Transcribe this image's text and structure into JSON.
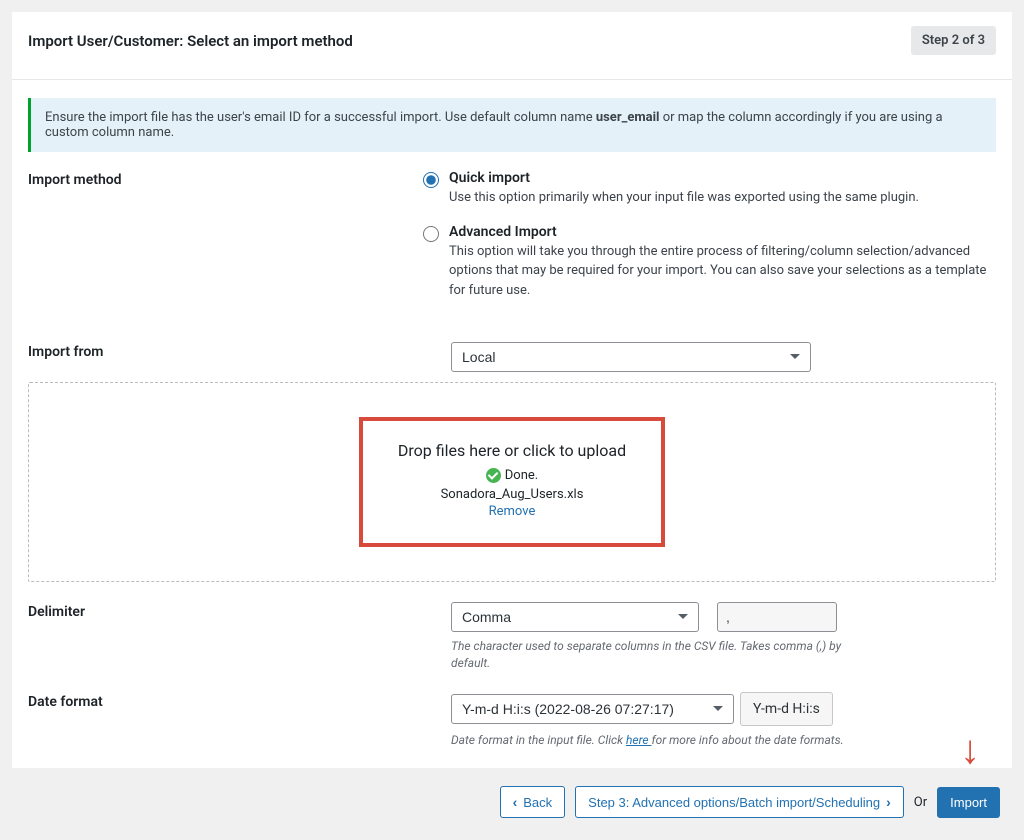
{
  "header": {
    "title": "Import User/Customer: Select an import method",
    "step_badge": "Step 2 of 3"
  },
  "notice": {
    "prefix": "Ensure the import file has the user's email ID for a successful import. Use default column name ",
    "bold": "user_email",
    "suffix": " or map the column accordingly if you are using a custom column name."
  },
  "labels": {
    "import_method": "Import method",
    "import_from": "Import from",
    "delimiter": "Delimiter",
    "date_format": "Date format"
  },
  "method": {
    "quick_title": "Quick import",
    "quick_desc": "Use this option primarily when your input file was exported using the same plugin.",
    "advanced_title": "Advanced Import",
    "advanced_desc": "This option will take you through the entire process of filtering/column selection/advanced options that may be required for your import. You can also save your selections as a template for future use."
  },
  "import_from": {
    "selected": "Local"
  },
  "dropzone": {
    "title": "Drop files here or click to upload",
    "status": "Done.",
    "filename": "Sonadora_Aug_Users.xls",
    "remove": "Remove"
  },
  "delimiter": {
    "selected": "Comma",
    "value": ",",
    "help": "The character used to separate columns in the CSV file. Takes comma (,) by default."
  },
  "date_format": {
    "selected": "Y-m-d H:i:s (2022-08-26 07:27:17)",
    "example": "Y-m-d H:i:s",
    "help_prefix": "Date format in the input file. Click ",
    "help_link": "here ",
    "help_suffix": "for more info about the date formats."
  },
  "footer": {
    "back": "Back",
    "step3": "Step 3: Advanced options/Batch import/Scheduling",
    "or": "Or",
    "import": "Import"
  }
}
